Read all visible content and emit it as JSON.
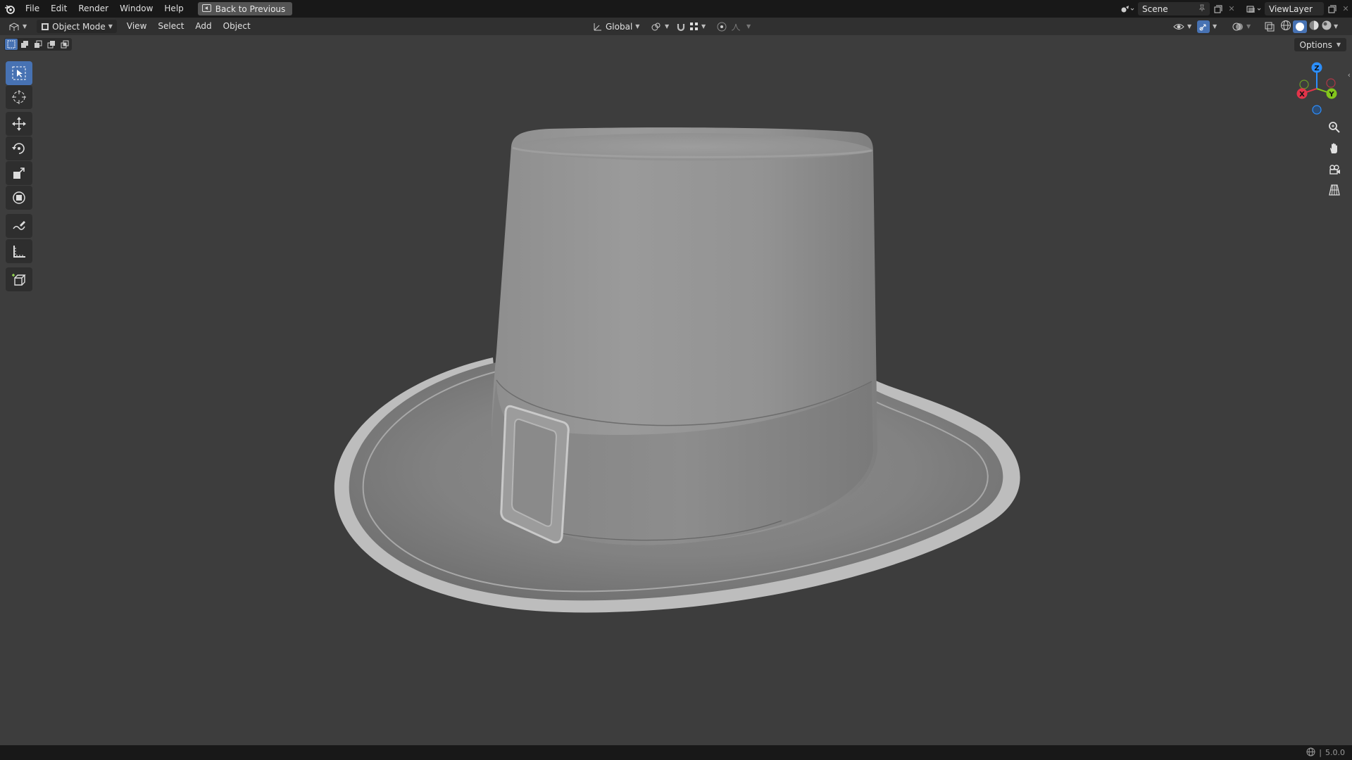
{
  "topbar": {
    "menus": [
      "File",
      "Edit",
      "Render",
      "Window",
      "Help"
    ],
    "back_label": "Back to Previous",
    "scene_name": "Scene",
    "view_layer_name": "ViewLayer"
  },
  "viewport_header": {
    "mode": "Object Mode",
    "menus": [
      "View",
      "Select",
      "Add",
      "Object"
    ],
    "transform_orientation": "Global",
    "options_label": "Options"
  },
  "toolbar": {
    "tools": [
      {
        "name": "select-box",
        "active": true
      },
      {
        "name": "cursor",
        "active": false
      },
      {
        "name": "move",
        "active": false
      },
      {
        "name": "rotate",
        "active": false
      },
      {
        "name": "scale",
        "active": false
      },
      {
        "name": "transform",
        "active": false
      },
      {
        "name": "annotate",
        "active": false
      },
      {
        "name": "measure",
        "active": false
      },
      {
        "name": "add-cube",
        "active": false
      }
    ]
  },
  "gizmo": {
    "axes": {
      "x": "X",
      "y": "Y",
      "z": "Z"
    },
    "colors": {
      "x": "#e3344a",
      "y": "#83c61c",
      "z": "#2c8fff"
    }
  },
  "statusbar": {
    "version": "5.0.0"
  },
  "colors": {
    "accent": "#4772b3",
    "viewport_bg": "#3d3d3d",
    "header_bg": "#303030",
    "topbar_bg": "#181818"
  }
}
